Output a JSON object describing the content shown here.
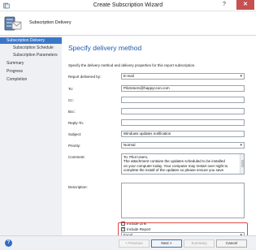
{
  "window": {
    "title": "Create Subscription Wizard",
    "help_label": "?",
    "close_label": "✕"
  },
  "header": {
    "title": "Subscription Delivery"
  },
  "nav": {
    "items": [
      {
        "label": "Subscription Delivery"
      },
      {
        "label": "Subscription Schedule"
      },
      {
        "label": "Subscription Parameters"
      },
      {
        "label": "Summary"
      },
      {
        "label": "Progress"
      },
      {
        "label": "Completion"
      }
    ]
  },
  "page": {
    "heading": "Specify delivery method",
    "intro": "Specify the delivery method and delivery properties for this report subscription."
  },
  "form": {
    "delivered_by": {
      "label": "Report delivered by:",
      "value": "E-mail"
    },
    "to": {
      "label": "To:",
      "value": "PilotUsers@happyccon.com"
    },
    "cc": {
      "label": "Cc:",
      "value": ""
    },
    "bcc": {
      "label": "Bcc:",
      "value": ""
    },
    "reply_to": {
      "label": "Reply-To:",
      "value": ""
    },
    "subject": {
      "label": "Subject:",
      "value": "Windows updates notification"
    },
    "priority": {
      "label": "Priority:",
      "value": "Normal"
    },
    "comment": {
      "label": "Comment:",
      "line1": "To: Pilot Users,",
      "line2": "The attachment contains the updates scheduled to be installed",
      "line3": "on your computer today. Your computer may restart over night to",
      "line4": "complete the install of the updates so please ensure you save"
    },
    "description": {
      "label": "Description:",
      "value": ""
    },
    "include_link": {
      "label": "Include Link",
      "checked": false
    },
    "include_report": {
      "label": "Include Report",
      "checked": true
    },
    "render_format": {
      "label": "Render Format:",
      "value": "Excel"
    }
  },
  "footer": {
    "help_label": "?",
    "previous_label": "< Previous",
    "next_label": "Next >",
    "summary_label": "Summary",
    "cancel_label": "Cancel"
  },
  "colors": {
    "accent": "#3a77c9",
    "heading": "#1e5aa8",
    "highlight": "#e04848"
  }
}
